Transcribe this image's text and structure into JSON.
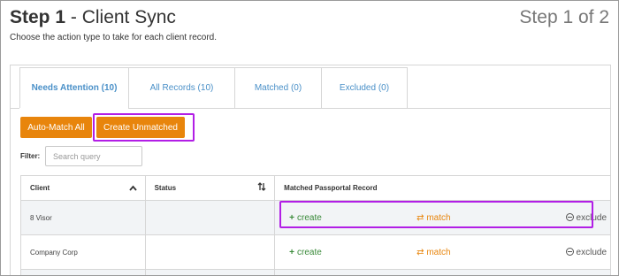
{
  "header": {
    "step_label": "Step 1",
    "title_rest": " - Client Sync",
    "step_count": "Step 1 of 2",
    "subtitle": "Choose the action type to take for each client record."
  },
  "tabs": [
    {
      "label": "Needs Attention (10)",
      "active": true
    },
    {
      "label": "All Records (10)",
      "active": false
    },
    {
      "label": "Matched (0)",
      "active": false
    },
    {
      "label": "Excluded (0)",
      "active": false
    }
  ],
  "toolbar": {
    "auto_match_label": "Auto-Match All",
    "create_unmatched_label": "Create Unmatched"
  },
  "filter": {
    "label": "Filter:",
    "placeholder": "Search query"
  },
  "grid": {
    "columns": [
      "Client",
      "Status",
      "Matched Passportal Record"
    ],
    "rows": [
      {
        "client": "8 Visor",
        "status": "",
        "actions": {
          "create": "create",
          "match": "match",
          "exclude": "exclude"
        }
      },
      {
        "client": "Company Corp",
        "status": "",
        "actions": {
          "create": "create",
          "match": "match",
          "exclude": "exclude"
        }
      }
    ]
  },
  "icons": {
    "sort_up": "chevron-up-icon",
    "sort_both": "sort-arrows-icon",
    "create": "plus-icon",
    "match": "swap-arrows-icon",
    "exclude": "circle-minus-icon"
  },
  "colors": {
    "accent_orange": "#e8850c",
    "link_blue": "#4a90c8",
    "create_green": "#3a8a3a",
    "highlight_purple": "#b21ee6"
  }
}
